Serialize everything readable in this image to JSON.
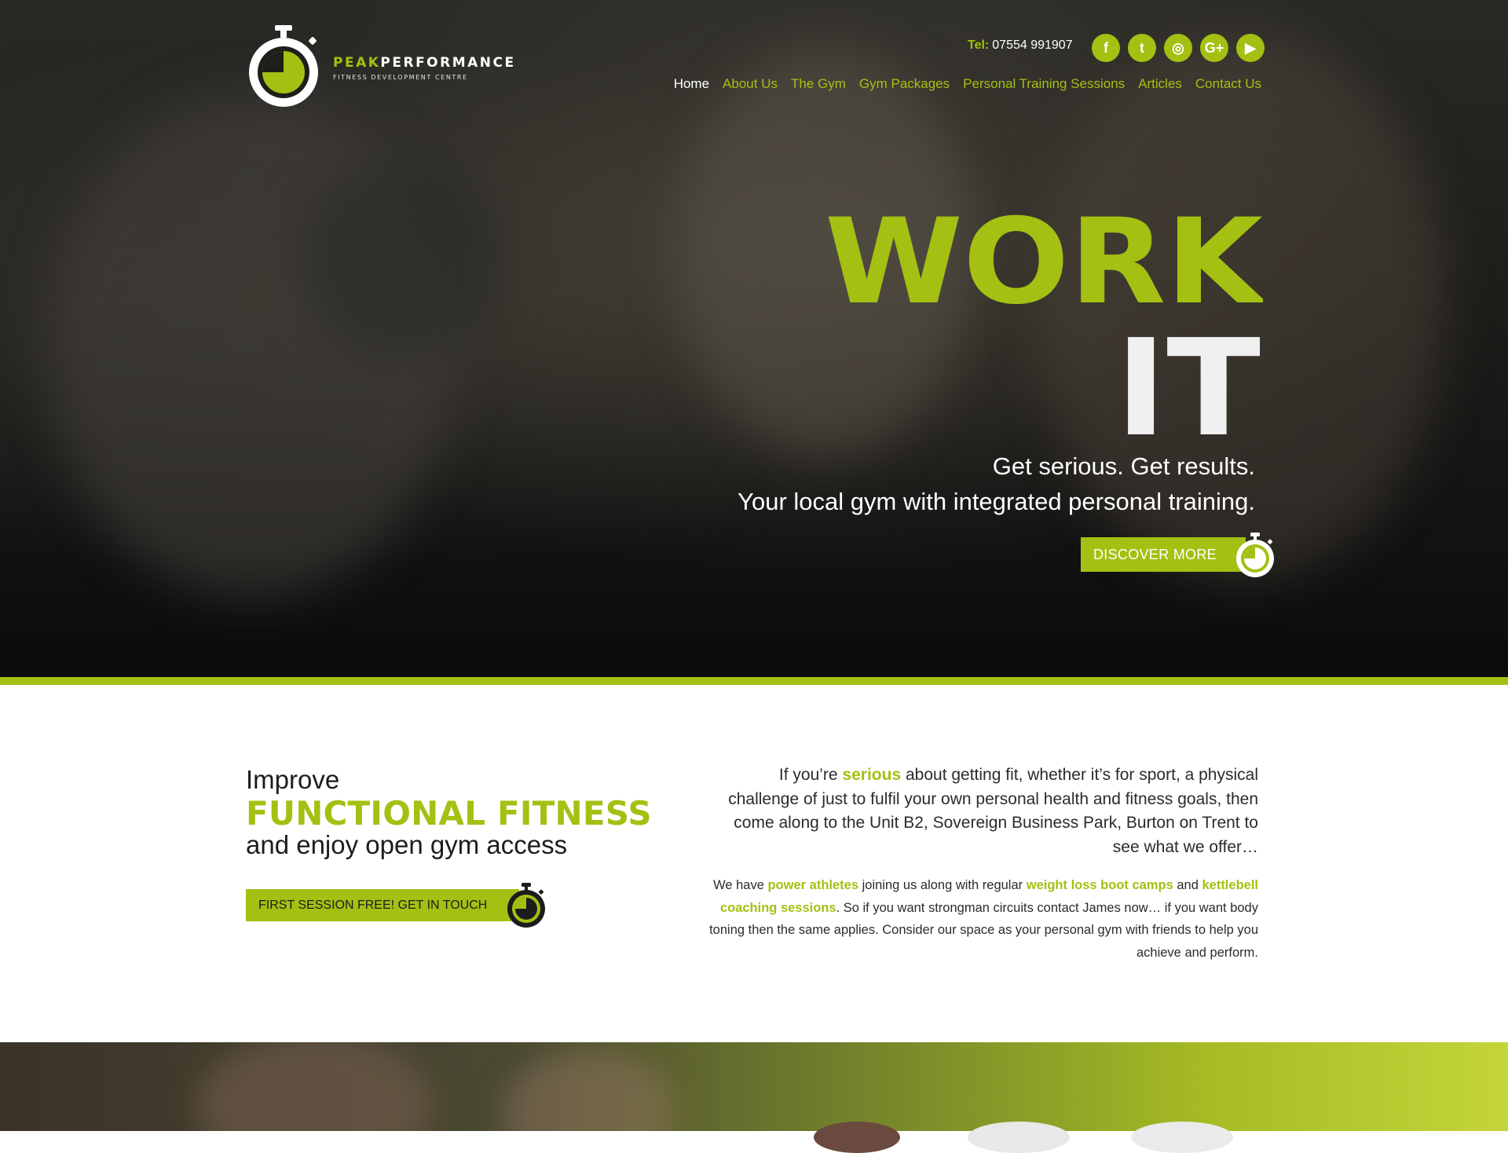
{
  "brand": {
    "name_accent": "PEAK",
    "name_rest": "PERFORMANCE",
    "subtitle": "FITNESS DEVELOPMENT CENTRE"
  },
  "header": {
    "tel_label": "Tel:",
    "tel_number": "07554 991907",
    "social": [
      {
        "icon": "facebook-icon",
        "glyph": "f"
      },
      {
        "icon": "twitter-icon",
        "glyph": "t"
      },
      {
        "icon": "instagram-icon",
        "glyph": "◎"
      },
      {
        "icon": "google-plus-icon",
        "glyph": "G+"
      },
      {
        "icon": "youtube-icon",
        "glyph": "▶"
      }
    ],
    "nav": [
      {
        "label": "Home",
        "active": true
      },
      {
        "label": "About Us",
        "active": false
      },
      {
        "label": "The Gym",
        "active": false
      },
      {
        "label": "Gym Packages",
        "active": false
      },
      {
        "label": "Personal Training Sessions",
        "active": false
      },
      {
        "label": "Articles",
        "active": false
      },
      {
        "label": "Contact Us",
        "active": false
      }
    ]
  },
  "hero": {
    "headline_1": "WORK",
    "headline_2": "IT",
    "tagline_1": "Get serious. Get results.",
    "tagline_2": "Your local gym with integrated personal training.",
    "cta": "DISCOVER MORE"
  },
  "intro": {
    "line1": "Improve",
    "line2": "FUNCTIONAL FITNESS",
    "line3": "and enjoy open gym access",
    "cta": "FIRST SESSION FREE! GET IN TOUCH",
    "p1": {
      "a": "If you’re ",
      "b": "serious",
      "c": " about getting fit, whether it’s for sport, a physical challenge of just to fulfil your own personal health and fitness goals, then come along to the Unit B2, Sovereign Business Park, Burton on Trent to see what we offer…"
    },
    "p2": {
      "a": "We have ",
      "b": "power athletes",
      "c": " joining us along with regular ",
      "d": "weight loss boot camps",
      "e": " and ",
      "f": "kettlebell coaching sessions",
      "g": ". So if you want strongman circuits contact James now… if you want body toning then the same applies. Consider our space as your personal gym with friends to help you achieve and perform."
    }
  },
  "colors": {
    "accent": "#a4c012",
    "dark": "#121212",
    "text": "#1d1d1d"
  }
}
